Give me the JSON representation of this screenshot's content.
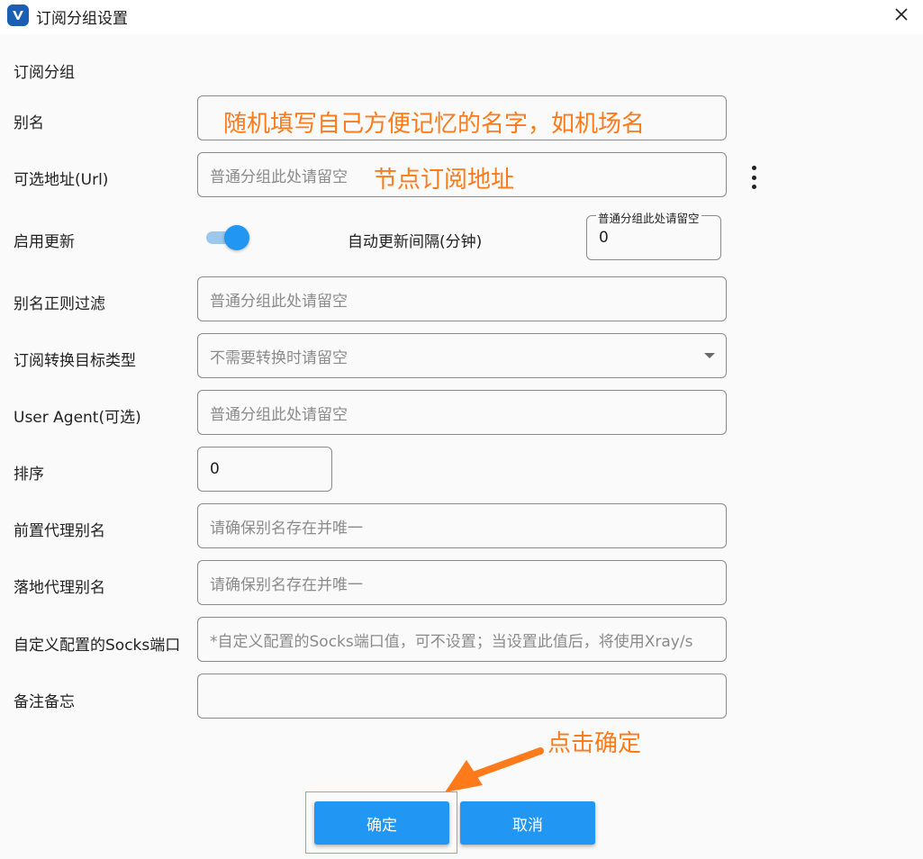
{
  "window": {
    "title": "订阅分组设置",
    "app_icon_letter": "V"
  },
  "form": {
    "section_title": "订阅分组",
    "alias": {
      "label": "别名",
      "value": ""
    },
    "url": {
      "label": "可选地址(Url)",
      "placeholder": "普通分组此处请留空"
    },
    "enable_update": {
      "label": "启用更新",
      "checked": true
    },
    "auto_update_interval": {
      "label": "自动更新间隔(分钟)",
      "float_label": "普通分组此处请留空",
      "value": "0"
    },
    "alias_filter": {
      "label": "别名正则过滤",
      "placeholder": "普通分组此处请留空"
    },
    "convert_target": {
      "label": "订阅转换目标类型",
      "placeholder": "不需要转换时请留空"
    },
    "user_agent": {
      "label": "User Agent(可选)",
      "placeholder": "普通分组此处请留空"
    },
    "sort": {
      "label": "排序",
      "value": "0"
    },
    "prev_proxy": {
      "label": "前置代理别名",
      "placeholder": "请确保别名存在并唯一"
    },
    "next_proxy": {
      "label": "落地代理别名",
      "placeholder": "请确保别名存在并唯一"
    },
    "socks_port": {
      "label": "自定义配置的Socks端口",
      "placeholder": "*自定义配置的Socks端口值，可不设置；当设置此值后，将使用Xray/s"
    },
    "memo": {
      "label": "备注备忘",
      "value": ""
    }
  },
  "buttons": {
    "ok": "确定",
    "cancel": "取消"
  },
  "annotations": {
    "alias_hint": "随机填写自己方便记忆的名字，如机场名",
    "url_hint": "节点订阅地址",
    "click_ok": "点击确定",
    "color": "#ff7a1a"
  },
  "colors": {
    "accent": "#2196f3",
    "toggle_track": "#9cc8ee",
    "highlight": "#ff8a3a"
  }
}
